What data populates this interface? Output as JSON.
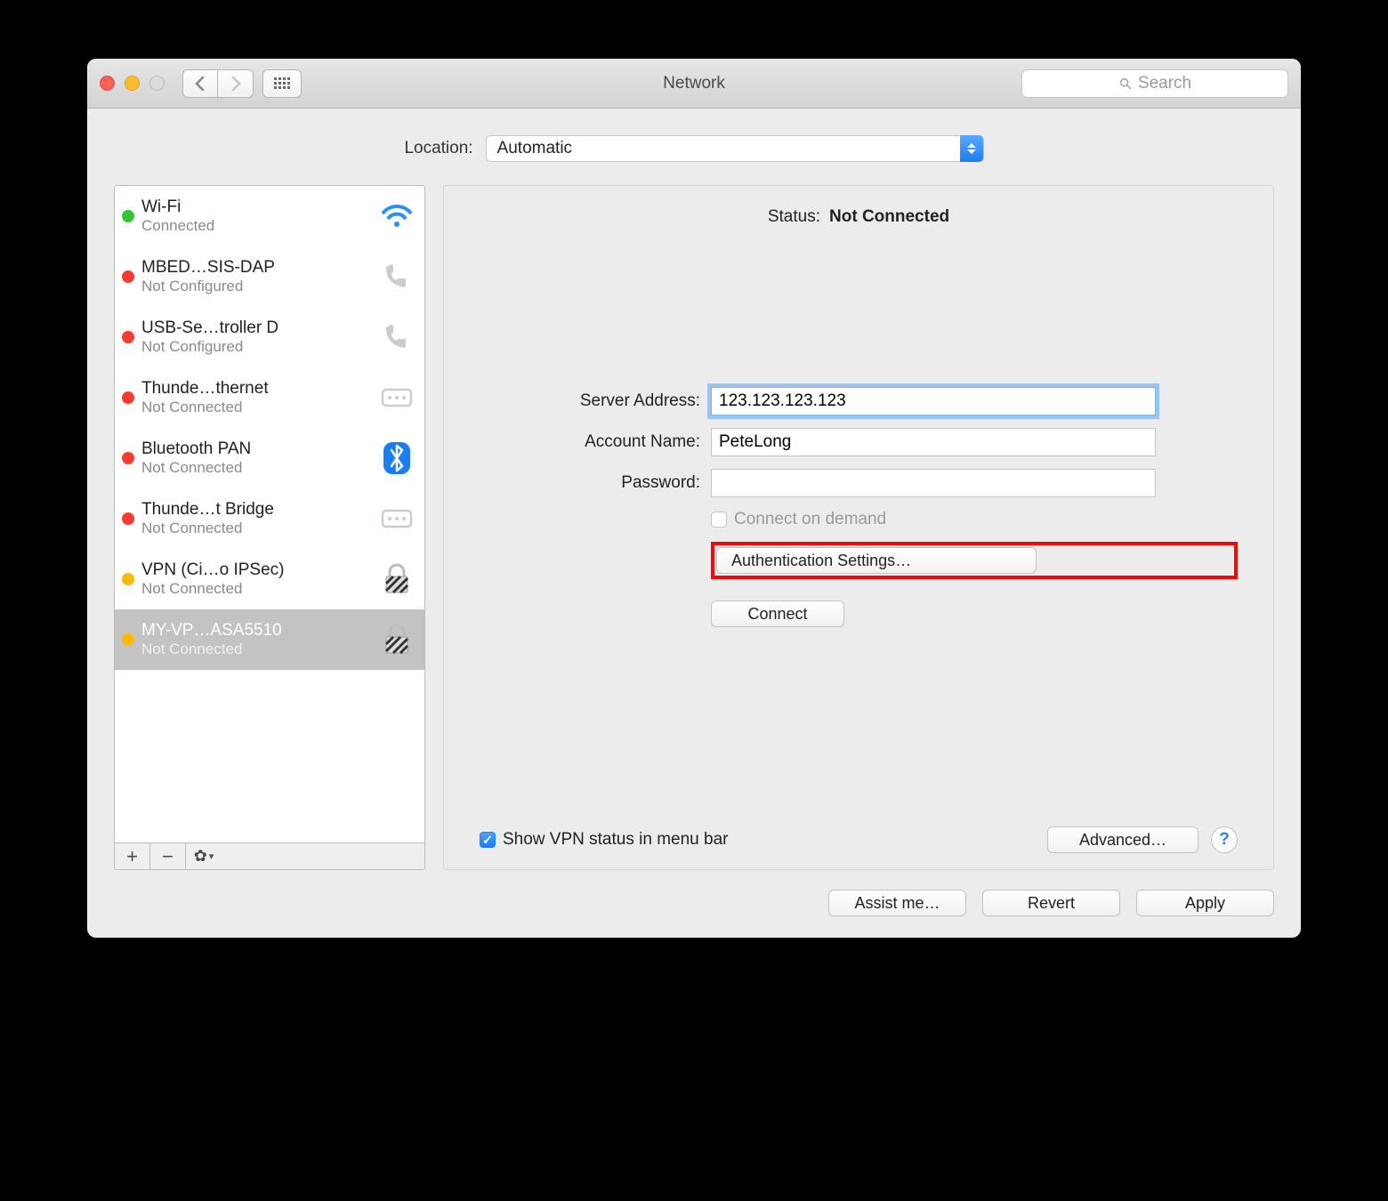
{
  "window": {
    "title": "Network",
    "search_placeholder": "Search"
  },
  "location": {
    "label": "Location:",
    "value": "Automatic"
  },
  "sidebar": {
    "services": [
      {
        "name": "Wi-Fi",
        "status": "Connected",
        "dot": "green",
        "icon": "wifi"
      },
      {
        "name": "MBED…SIS-DAP",
        "status": "Not Configured",
        "dot": "red",
        "icon": "phone"
      },
      {
        "name": "USB-Se…troller D",
        "status": "Not Configured",
        "dot": "red",
        "icon": "phone"
      },
      {
        "name": "Thunde…thernet",
        "status": "Not Connected",
        "dot": "red",
        "icon": "ethernet"
      },
      {
        "name": "Bluetooth PAN",
        "status": "Not Connected",
        "dot": "red",
        "icon": "bluetooth"
      },
      {
        "name": "Thunde…t Bridge",
        "status": "Not Connected",
        "dot": "red",
        "icon": "ethernet"
      },
      {
        "name": "VPN (Ci…o IPSec)",
        "status": "Not Connected",
        "dot": "orange",
        "icon": "lock"
      },
      {
        "name": "MY-VP…ASA5510",
        "status": "Not Connected",
        "dot": "orange",
        "icon": "lock",
        "selected": true
      }
    ]
  },
  "panel": {
    "status_label": "Status:",
    "status_value": "Not Connected",
    "server_address_label": "Server Address:",
    "server_address_value": "123.123.123.123",
    "account_name_label": "Account Name:",
    "account_name_value": "PeteLong",
    "password_label": "Password:",
    "password_value": "",
    "connect_on_demand_label": "Connect on demand",
    "auth_settings_label": "Authentication Settings…",
    "connect_label": "Connect",
    "show_vpn_label": "Show VPN status in menu bar",
    "advanced_label": "Advanced…",
    "help_label": "?"
  },
  "buttons": {
    "assist": "Assist me…",
    "revert": "Revert",
    "apply": "Apply"
  }
}
